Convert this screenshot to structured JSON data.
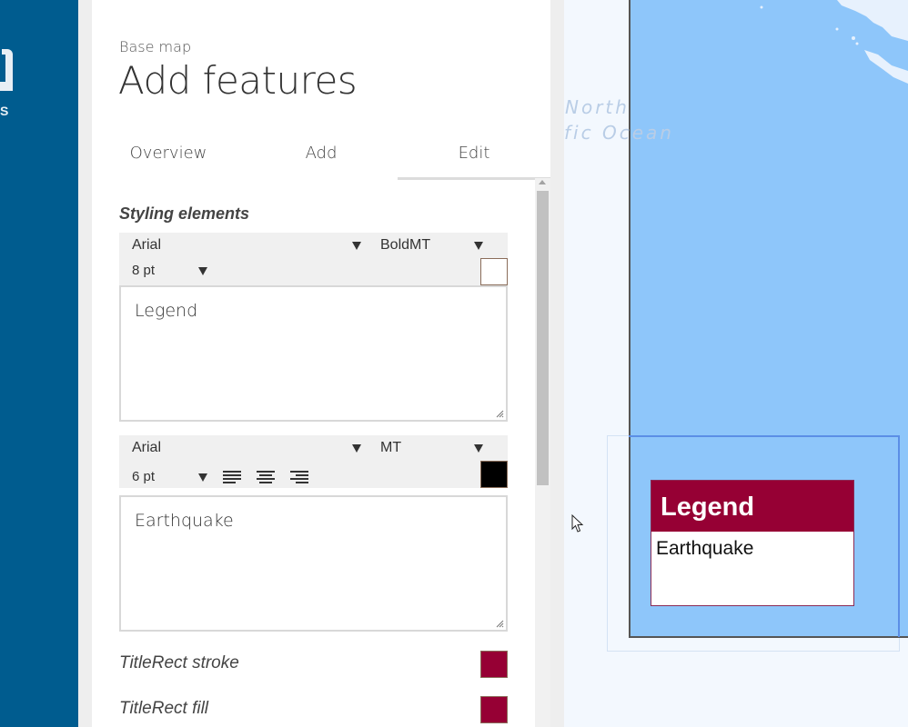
{
  "sidebar": {
    "logo_text": "S"
  },
  "panel": {
    "breadcrumb": "Base map",
    "title": "Add features",
    "tabs": [
      {
        "label": "Overview"
      },
      {
        "label": "Add"
      },
      {
        "label": "Edit"
      }
    ],
    "section_heading": "Styling elements",
    "title_style": {
      "font": "Arial",
      "weight": "BoldMT",
      "size": "8 pt",
      "color": "#ffffff",
      "text": "Legend"
    },
    "body_style": {
      "font": "Arial",
      "weight": "MT",
      "size": "6 pt",
      "color": "#000000",
      "text": "Earthquake",
      "align_icons": [
        "align-left-icon",
        "align-center-icon",
        "align-right-icon"
      ]
    },
    "properties": [
      {
        "label": "TitleRect stroke",
        "color": "#960034"
      },
      {
        "label": "TitleRect fill",
        "color": "#960034"
      }
    ]
  },
  "map": {
    "ocean_label_line1": "North",
    "ocean_label_line2": "fic Ocean",
    "legend": {
      "title": "Legend",
      "item": "Earthquake",
      "title_bg": "#960034"
    }
  }
}
